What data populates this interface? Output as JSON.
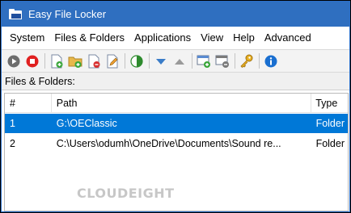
{
  "window": {
    "title": "Easy File Locker"
  },
  "menubar": {
    "items": [
      "System",
      "Files & Folders",
      "Applications",
      "View",
      "Help",
      "Advanced"
    ]
  },
  "toolbar": {
    "buttons": [
      "start-icon",
      "stop-icon",
      "add-file-icon",
      "add-folder-icon",
      "remove-icon",
      "edit-icon",
      "toggle-icon",
      "move-down-icon",
      "move-up-icon",
      "add-application-icon",
      "remove-application-icon",
      "password-key-icon",
      "about-info-icon"
    ]
  },
  "section_label": "Files & Folders:",
  "list": {
    "columns": [
      "#",
      "Path",
      "Type"
    ],
    "rows": [
      {
        "num": "1",
        "path": "G:\\OEClassic",
        "type": "Folder",
        "selected": true
      },
      {
        "num": "2",
        "path": "C:\\Users\\odumh\\OneDrive\\Documents\\Sound re...",
        "type": "Folder",
        "selected": false
      }
    ]
  },
  "watermark": "CLOUDEIGHT",
  "colors": {
    "titlebar": "#2f6fc0",
    "selection": "#0078d7"
  }
}
